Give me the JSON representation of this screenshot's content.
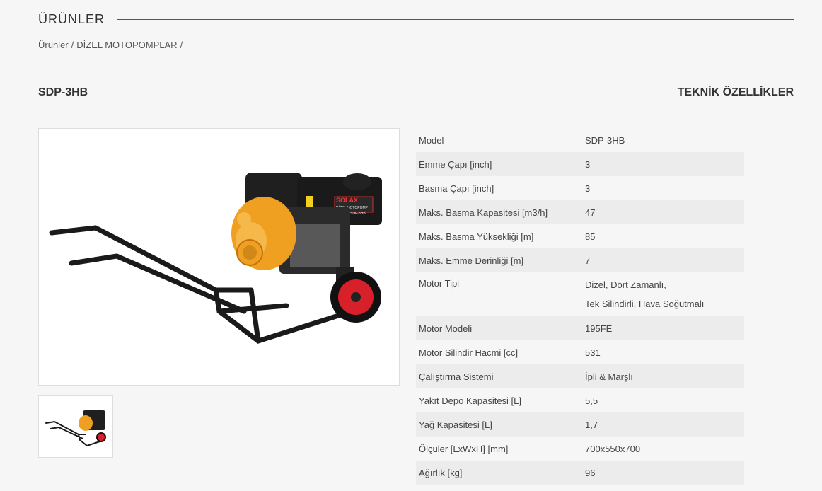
{
  "header": {
    "title": "ÜRÜNLER"
  },
  "breadcrumb": {
    "items": [
      "Ürünler",
      "DİZEL MOTOPOMPLAR"
    ],
    "separator": "/"
  },
  "product": {
    "name": "SDP-3HB",
    "brand_text": "SOLAX",
    "badge_text": "DİZEL MOTOPOMP",
    "model_text": "SDP-3HB"
  },
  "specs_heading": "TEKNİK ÖZELLİKLER",
  "specs": [
    {
      "key": "Model",
      "value": "SDP-3HB"
    },
    {
      "key": "Emme Çapı [inch]",
      "value": "3"
    },
    {
      "key": "Basma Çapı [inch]",
      "value": "3"
    },
    {
      "key": "Maks. Basma Kapasitesi [m3/h]",
      "value": "47"
    },
    {
      "key": "Maks. Basma Yüksekliği [m]",
      "value": "85"
    },
    {
      "key": "Maks. Emme Derinliği [m]",
      "value": "7"
    },
    {
      "key": "Motor Tipi",
      "value": "Dizel, Dört Zamanlı,",
      "value2": "Tek Silindirli, Hava Soğutmalı"
    },
    {
      "key": "Motor Modeli",
      "value": "195FE"
    },
    {
      "key": "Motor Silindir Hacmi [cc]",
      "value": "531"
    },
    {
      "key": "Çalıştırma Sistemi",
      "value": "İpli & Marşlı"
    },
    {
      "key": "Yakıt Depo Kapasitesi [L]",
      "value": "5,5"
    },
    {
      "key": "Yağ Kapasitesi [L]",
      "value": "1,7"
    },
    {
      "key": "Ölçüler [LxWxH] [mm]",
      "value": "700x550x700"
    },
    {
      "key": "Ağırlık [kg]",
      "value": "96"
    }
  ],
  "colors": {
    "pump_orange": "#f0a020",
    "wheel_red": "#d8202a",
    "frame_black": "#1a1a1a"
  }
}
